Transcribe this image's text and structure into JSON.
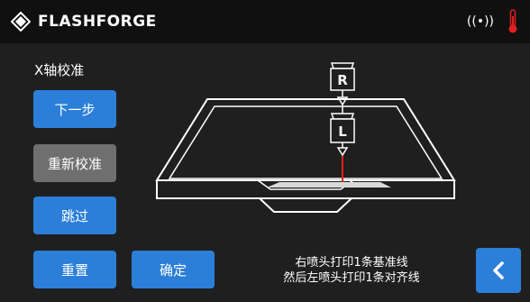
{
  "header": {
    "brand": "FLASHFORGE",
    "icons": [
      "flashforge-logo-icon",
      "wifi-signal-icon",
      "thermometer-icon"
    ],
    "wifi_glyph": "((•))"
  },
  "page": {
    "title": "X轴校准"
  },
  "buttons": {
    "next": "下一步",
    "recalibrate": "重新校准",
    "skip": "跳过",
    "reset": "重置",
    "confirm": "确定"
  },
  "illustration": {
    "nozzle_right_label": "R",
    "nozzle_left_label": "L"
  },
  "instructions": {
    "line1": "右喷头打印1条基准线",
    "line2": "然后左喷头打印1条对齐线"
  },
  "colors": {
    "accent": "#2b7fd9",
    "secondary_button": "#6f6f6f",
    "background": "#1f1f1f",
    "header_background": "#101010",
    "thermometer": "#e02020",
    "left_line": "#e02020"
  }
}
